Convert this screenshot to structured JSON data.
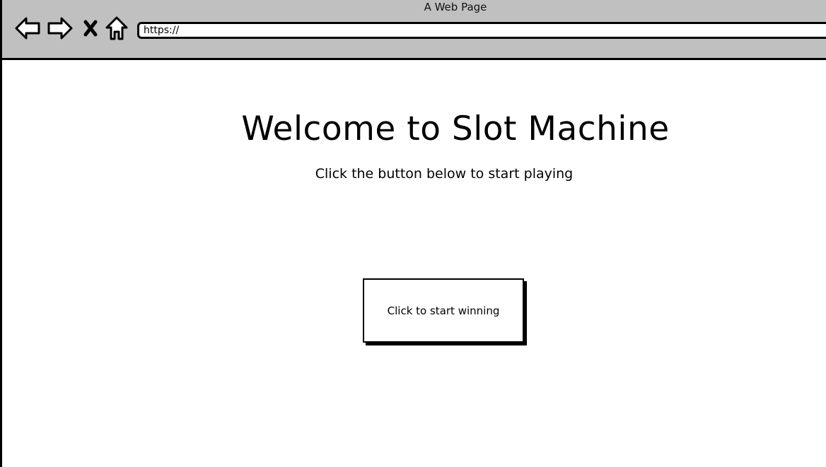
{
  "window": {
    "title": "A Web Page"
  },
  "toolbar": {
    "back_icon": "back-arrow-icon",
    "forward_icon": "forward-arrow-icon",
    "stop_icon": "close-icon",
    "home_icon": "home-icon",
    "url_value": "https://"
  },
  "main": {
    "headline": "Welcome to Slot Machine",
    "subtext": "Click the button below to start playing",
    "start_button_label": "Click to start winning"
  }
}
